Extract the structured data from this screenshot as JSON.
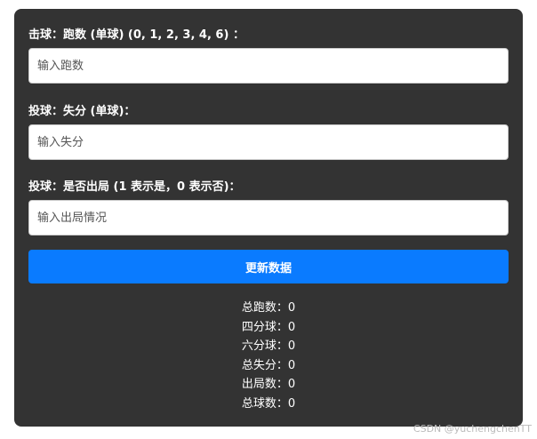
{
  "form": {
    "runs_label": "击球：跑数 (单球) (0, 1, 2, 3, 4, 6) ：",
    "runs_placeholder": "输入跑数",
    "runs_value": "",
    "conceded_label": "投球：失分 (单球)：",
    "conceded_placeholder": "输入失分",
    "conceded_value": "",
    "wicket_label": "投球：是否出局 (1 表示是，0 表示否)：",
    "wicket_placeholder": "输入出局情况",
    "wicket_value": "",
    "update_button": "更新数据"
  },
  "stats": [
    {
      "label": "总跑数：",
      "value": "0"
    },
    {
      "label": "四分球：",
      "value": "0"
    },
    {
      "label": "六分球：",
      "value": "0"
    },
    {
      "label": "总失分：",
      "value": "0"
    },
    {
      "label": "出局数：",
      "value": "0"
    },
    {
      "label": "总球数：",
      "value": "0"
    }
  ],
  "watermark": "CSDN @yuchengchenTT"
}
